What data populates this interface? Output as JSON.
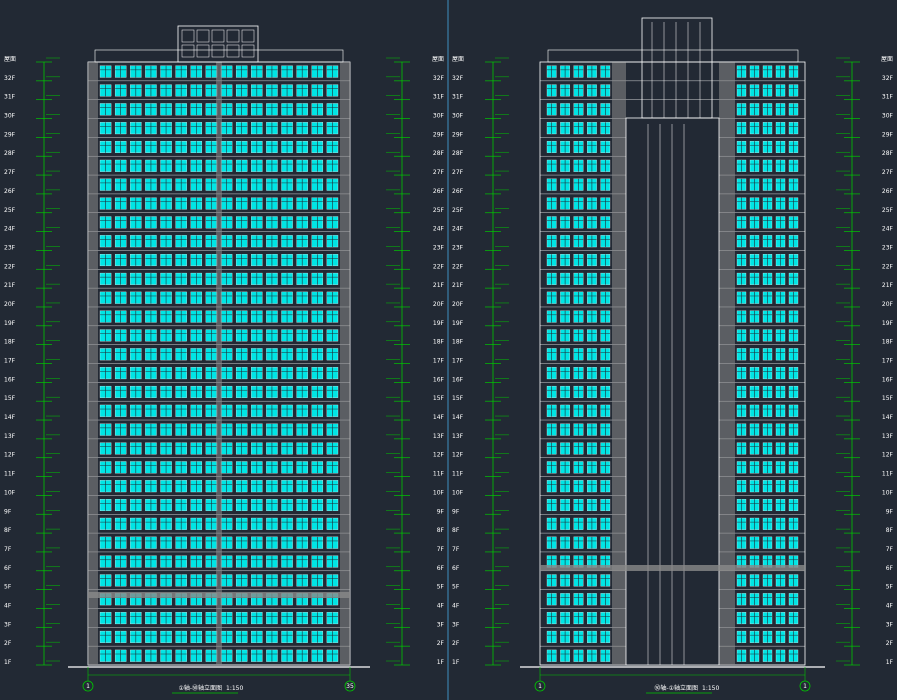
{
  "drawings": [
    {
      "id": "left",
      "axis_left": "1",
      "axis_right": "35",
      "caption": "①轴-㊿轴立面图",
      "scale": "1:150"
    },
    {
      "id": "right",
      "axis_left": "1",
      "axis_right": "1",
      "caption": "㊿轴-①轴立面图",
      "scale": "1:150"
    }
  ],
  "floor_labels": [
    "1F",
    "2F",
    "3F",
    "4F",
    "5F",
    "6F",
    "7F",
    "8F",
    "9F",
    "10F",
    "11F",
    "12F",
    "13F",
    "14F",
    "15F",
    "16F",
    "17F",
    "18F",
    "19F",
    "20F",
    "21F",
    "22F",
    "23F",
    "24F",
    "25F",
    "26F",
    "27F",
    "28F",
    "29F",
    "30F",
    "31F",
    "32F",
    "屋面"
  ],
  "colors": {
    "background": "#222934",
    "window": "#00e5e5",
    "wall_line": "#ffffff",
    "dimension_line": "#00c800",
    "stone": "#8a8a8a",
    "divider": "#3f8fbf"
  }
}
